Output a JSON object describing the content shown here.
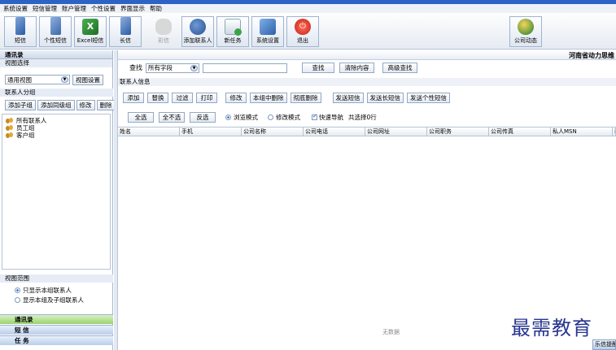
{
  "menubar": {
    "items": [
      "系统设置",
      "短信管理",
      "账户管理",
      "个性设置",
      "界面显示",
      "帮助"
    ]
  },
  "toolbar": {
    "buttons": [
      {
        "label": "短信",
        "icon": "phone-icon"
      },
      {
        "label": "个性短信",
        "icon": "personal-sms-icon"
      },
      {
        "label": "Excel短信",
        "icon": "excel-icon"
      },
      {
        "label": "长信",
        "icon": "long-message-icon"
      },
      {
        "label": "彩信",
        "icon": "mms-icon"
      },
      {
        "label": "添加联系人",
        "icon": "add-contact-icon"
      },
      {
        "label": "新任务",
        "icon": "new-task-icon"
      },
      {
        "label": "系统设置",
        "icon": "settings-icon"
      },
      {
        "label": "退出",
        "icon": "power-icon"
      },
      {
        "label": "公司动态",
        "icon": "globe-icon"
      }
    ]
  },
  "left": {
    "header": "通讯录",
    "view_label": "视图选择",
    "view_value": "通用视图",
    "view_settings": "视图设置",
    "group_label": "联系人分组",
    "group_buttons": [
      "添加子组",
      "添加同级组",
      "修改",
      "删除"
    ],
    "tree": [
      "所有联系人",
      "员工组",
      "客户组"
    ],
    "range_label": "视图范围",
    "range_options": [
      "只显示本组联系人",
      "显示本组及子组联系人"
    ],
    "nav": [
      "通讯录",
      "短 信",
      "任 务"
    ]
  },
  "main": {
    "company": "河南省动力思维",
    "search_label": "查找",
    "search_field": "所有字段",
    "search_btn": "查找",
    "clear_btn": "清除内容",
    "advanced_btn": "高级查找",
    "section": "联系人信息",
    "actions": [
      "添加",
      "替换",
      "过滤",
      "打印",
      "修改",
      "本组中删除",
      "彻底删除",
      "发送短信",
      "发送长短信",
      "发送个性短信"
    ],
    "select_all": "全选",
    "select_none": "全不选",
    "invert": "反选",
    "mode_browse": "浏览模式",
    "mode_edit": "修改模式",
    "quick_nav": "快速导航",
    "selected_count": "共选择0行",
    "columns": [
      "姓名",
      "手机",
      "公司名称",
      "公司电话",
      "公司网址",
      "公司职务",
      "公司传真",
      "私人MSN",
      "私"
    ],
    "empty_text": "无数据"
  },
  "watermark": "最需教育",
  "corner_tab": "乐信提醒"
}
